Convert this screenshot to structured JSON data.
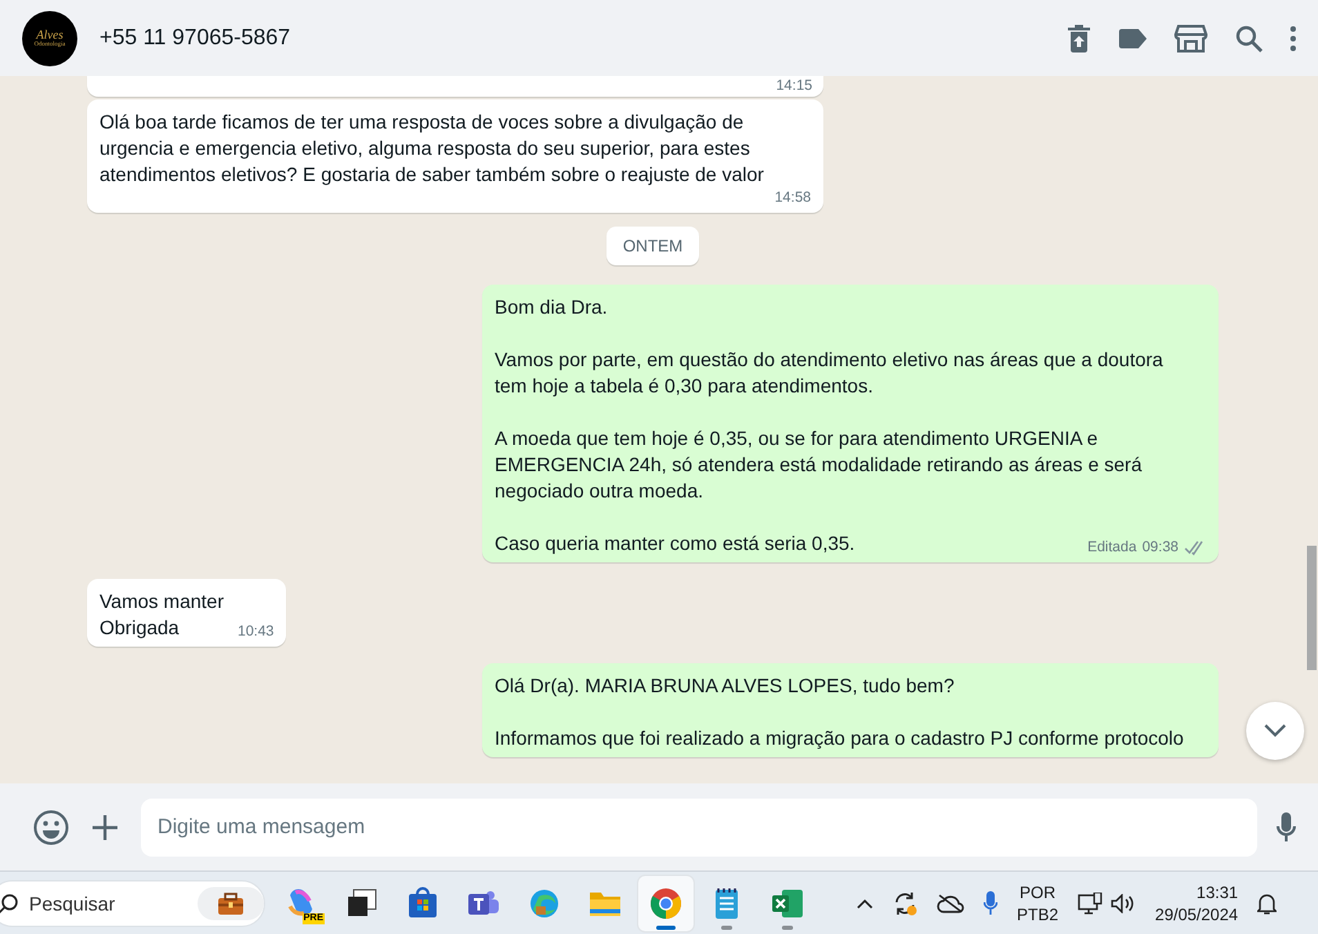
{
  "header": {
    "avatar_text": [
      "Alves",
      "Odontologia"
    ],
    "contact": "+55 11 97065-5867"
  },
  "messages": [
    {
      "kind": "in",
      "time": "14:15"
    },
    {
      "kind": "in",
      "paragraphs": [
        "Olá boa tarde ficamos de ter uma resposta de voces sobre a divulgação de urgencia e emergencia eletivo, alguma resposta do seu superior, para estes atendimentos eletivos? E gostaria de saber também sobre o reajuste de valor"
      ],
      "time": "14:58"
    },
    {
      "kind": "date",
      "label": "ONTEM"
    },
    {
      "kind": "out",
      "paragraphs": [
        "Bom dia Dra.",
        "Vamos por parte, em questão do atendimento eletivo nas áreas que a doutora tem hoje a tabela é 0,30 para atendimentos.",
        "A moeda que tem hoje é 0,35, ou se for para atendimento URGENIA e EMERGENCIA 24h, só atendera está modalidade retirando as áreas e será negociado outra moeda.",
        "Caso queria manter como está seria 0,35."
      ],
      "edited": "Editada",
      "time": "09:38",
      "read": false
    },
    {
      "kind": "in",
      "paragraphs": [
        "Vamos manter\nObrigada"
      ],
      "time": "10:43"
    },
    {
      "kind": "out",
      "paragraphs": [
        "Olá Dr(a). MARIA BRUNA ALVES LOPES, tudo bem?",
        "Informamos que foi realizado a migração para o cadastro PJ conforme protocolo"
      ]
    }
  ],
  "compose": {
    "placeholder": "Digite uma mensagem"
  },
  "taskbar": {
    "search_placeholder": "Pesquisar",
    "apps": [
      {
        "kind": "copilot",
        "badge": "PRE",
        "selected": false,
        "running": false
      },
      {
        "kind": "taskview",
        "selected": false,
        "running": false
      },
      {
        "kind": "store",
        "selected": false,
        "running": false
      },
      {
        "kind": "teams",
        "selected": false,
        "running": false
      },
      {
        "kind": "edge",
        "selected": false,
        "running": false
      },
      {
        "kind": "folder",
        "selected": false,
        "running": false
      },
      {
        "kind": "chrome",
        "selected": true,
        "running": true
      },
      {
        "kind": "notepad",
        "selected": false,
        "running": true
      },
      {
        "kind": "excel",
        "selected": false,
        "running": true
      }
    ],
    "language": [
      "POR",
      "PTB2"
    ],
    "time": "13:31",
    "date": "29/05/2024"
  }
}
